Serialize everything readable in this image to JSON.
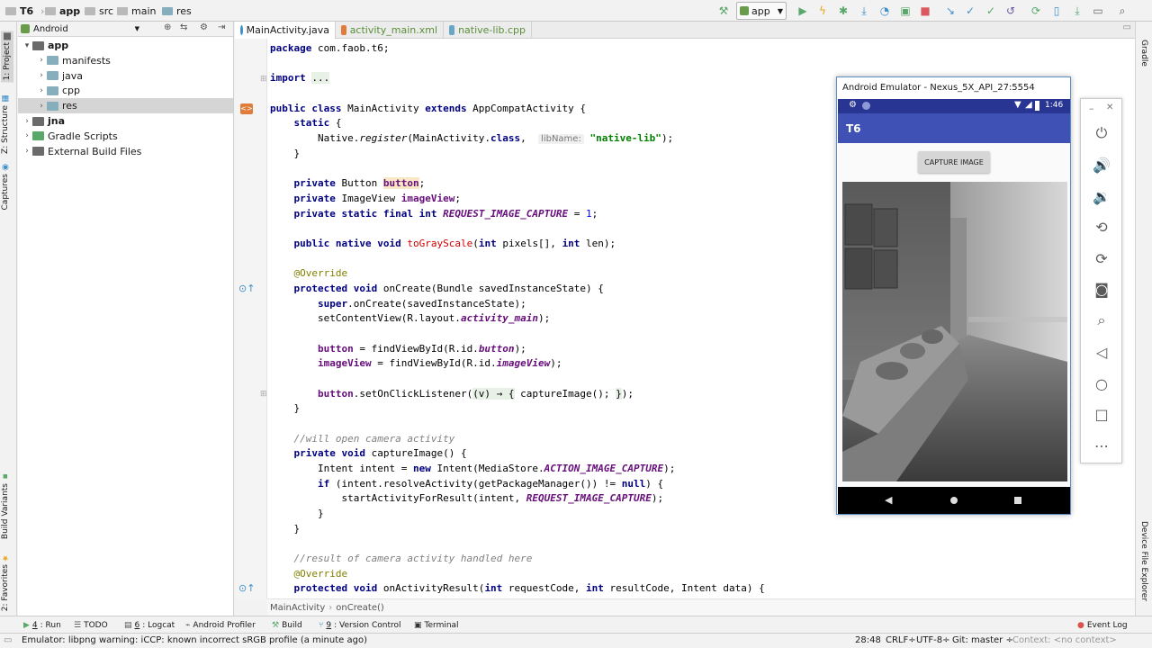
{
  "navbar": {
    "crumbs": [
      "T6",
      "app",
      "src",
      "main",
      "res"
    ],
    "run_config": "app"
  },
  "left_tool_tabs": [
    "1: Project",
    "Z: Structure",
    "Captures",
    "Build Variants",
    "2: Favorites"
  ],
  "right_tool_tabs": [
    "Gradle",
    "Device File Explorer"
  ],
  "project": {
    "view_mode": "Android",
    "tree": [
      {
        "label": "app",
        "depth": 0,
        "expanded": true,
        "bold": true,
        "icon": "module-icon"
      },
      {
        "label": "manifests",
        "depth": 1,
        "expanded": false,
        "icon": "folder-icon"
      },
      {
        "label": "java",
        "depth": 1,
        "expanded": false,
        "icon": "folder-icon"
      },
      {
        "label": "cpp",
        "depth": 1,
        "expanded": false,
        "icon": "folder-icon"
      },
      {
        "label": "res",
        "depth": 1,
        "expanded": false,
        "icon": "folder-icon",
        "selected": true
      },
      {
        "label": "jna",
        "depth": 0,
        "expanded": false,
        "bold": true,
        "icon": "module-icon"
      },
      {
        "label": "Gradle Scripts",
        "depth": 0,
        "expanded": false,
        "icon": "gradle-icon"
      },
      {
        "label": "External Build Files",
        "depth": 0,
        "expanded": false,
        "icon": "external-icon"
      }
    ]
  },
  "editor_tabs": [
    {
      "label": "MainActivity.java",
      "active": true,
      "icon_color": "#3d8fc9"
    },
    {
      "label": "activity_main.xml",
      "active": false,
      "icon_color": "#e07b39"
    },
    {
      "label": "native-lib.cpp",
      "active": false,
      "icon_color": "#6aa7c7"
    }
  ],
  "code": {
    "package_line": "package com.faob.t6;",
    "import_kw": "import",
    "import_fold": "...",
    "class_decl": [
      "public class",
      " MainActivity ",
      "extends",
      " AppCompatActivity {"
    ],
    "static_kw": "static",
    "static_brace": " {",
    "native_call": [
      "Native.",
      "register",
      "(MainActivity.",
      "class",
      ",  "
    ],
    "param_hint": "libName:",
    "lib_name": "\"native-lib\"",
    "native_end": ");",
    "close_brace": "}",
    "field_button": [
      "private",
      " Button ",
      "button",
      ";"
    ],
    "field_imageview": [
      "private",
      " ImageView ",
      "imageView",
      ";"
    ],
    "field_const": [
      "private static final int",
      " ",
      "REQUEST_IMAGE_CAPTURE",
      " = ",
      "1",
      ";"
    ],
    "native_method": [
      "public native void",
      " ",
      "toGrayScale",
      "(",
      "int",
      " pixels[], ",
      "int",
      " len);"
    ],
    "override": "@Override",
    "oncreate_decl": [
      "protected void",
      " onCreate(Bundle savedInstanceState) {"
    ],
    "super_call": [
      "super",
      ".onCreate(savedInstanceState);"
    ],
    "set_content": [
      "setContentView(R.layout.",
      "activity_main",
      ");"
    ],
    "find_button": [
      "button",
      " = findViewById(R.id.",
      "button",
      ");"
    ],
    "find_image": [
      "imageView",
      " = findViewById(R.id.",
      "imageView",
      ");"
    ],
    "set_listener": [
      "button",
      ".setOnClickListener(",
      "(v) → {",
      " captureImage(); ",
      "}",
      ");"
    ],
    "comment_open": "//will open camera activity",
    "capture_decl": [
      "private void",
      " captureImage() {"
    ],
    "intent_line": [
      "Intent intent = ",
      "new",
      " Intent(MediaStore.",
      "ACTION_IMAGE_CAPTURE",
      ");"
    ],
    "if_line": [
      "if",
      " (intent.resolveActivity(getPackageManager()) != ",
      "null",
      ") {"
    ],
    "start_line": [
      "startActivityForResult(intent, ",
      "REQUEST_IMAGE_CAPTURE",
      ");"
    ],
    "comment_result": "//result of camera activity handled here",
    "onresult_decl": [
      "protected void",
      " onActivityResult(",
      "int",
      " requestCode, ",
      "int",
      " resultCode, Intent data) {"
    ]
  },
  "editor_breadcrumb": [
    "MainActivity",
    "onCreate()"
  ],
  "emulator": {
    "title": "Android Emulator - Nexus_5X_API_27:5554",
    "clock": "1:46",
    "app_title": "T6",
    "button_label": "CAPTURE IMAGE",
    "min_icon": "–",
    "close_icon": "✕",
    "side_controls": [
      "power-icon",
      "volume-up-icon",
      "volume-down-icon",
      "rotate-left-icon",
      "rotate-right-icon",
      "camera-icon",
      "zoom-icon",
      "back-icon",
      "home-icon",
      "overview-icon",
      "more-icon"
    ]
  },
  "bottom_tools": [
    {
      "num": "4",
      "label": ": Run",
      "icon": "run-icon"
    },
    {
      "num": "",
      "label": "TODO",
      "icon": "todo-icon"
    },
    {
      "num": "6",
      "label": ": Logcat",
      "icon": "logcat-icon"
    },
    {
      "num": "",
      "label": "Android Profiler",
      "icon": "profiler-icon"
    },
    {
      "num": "",
      "label": "Build",
      "icon": "build-icon"
    },
    {
      "num": "9",
      "label": ": Version Control",
      "icon": "vcs-icon"
    },
    {
      "num": "",
      "label": "Terminal",
      "icon": "terminal-icon"
    }
  ],
  "event_log": "Event Log",
  "status": {
    "message": "Emulator: libpng warning: iCCP: known incorrect sRGB profile (a minute ago)",
    "position": "28:48",
    "line_sep": "CRLF÷",
    "encoding": "UTF-8÷",
    "git": "Git: master ÷",
    "context": "Context: <no context>"
  },
  "colors": {
    "accent": "#3f51b5",
    "status_bar": "#283593",
    "run_green": "#59a869",
    "stop_red": "#db5860"
  }
}
